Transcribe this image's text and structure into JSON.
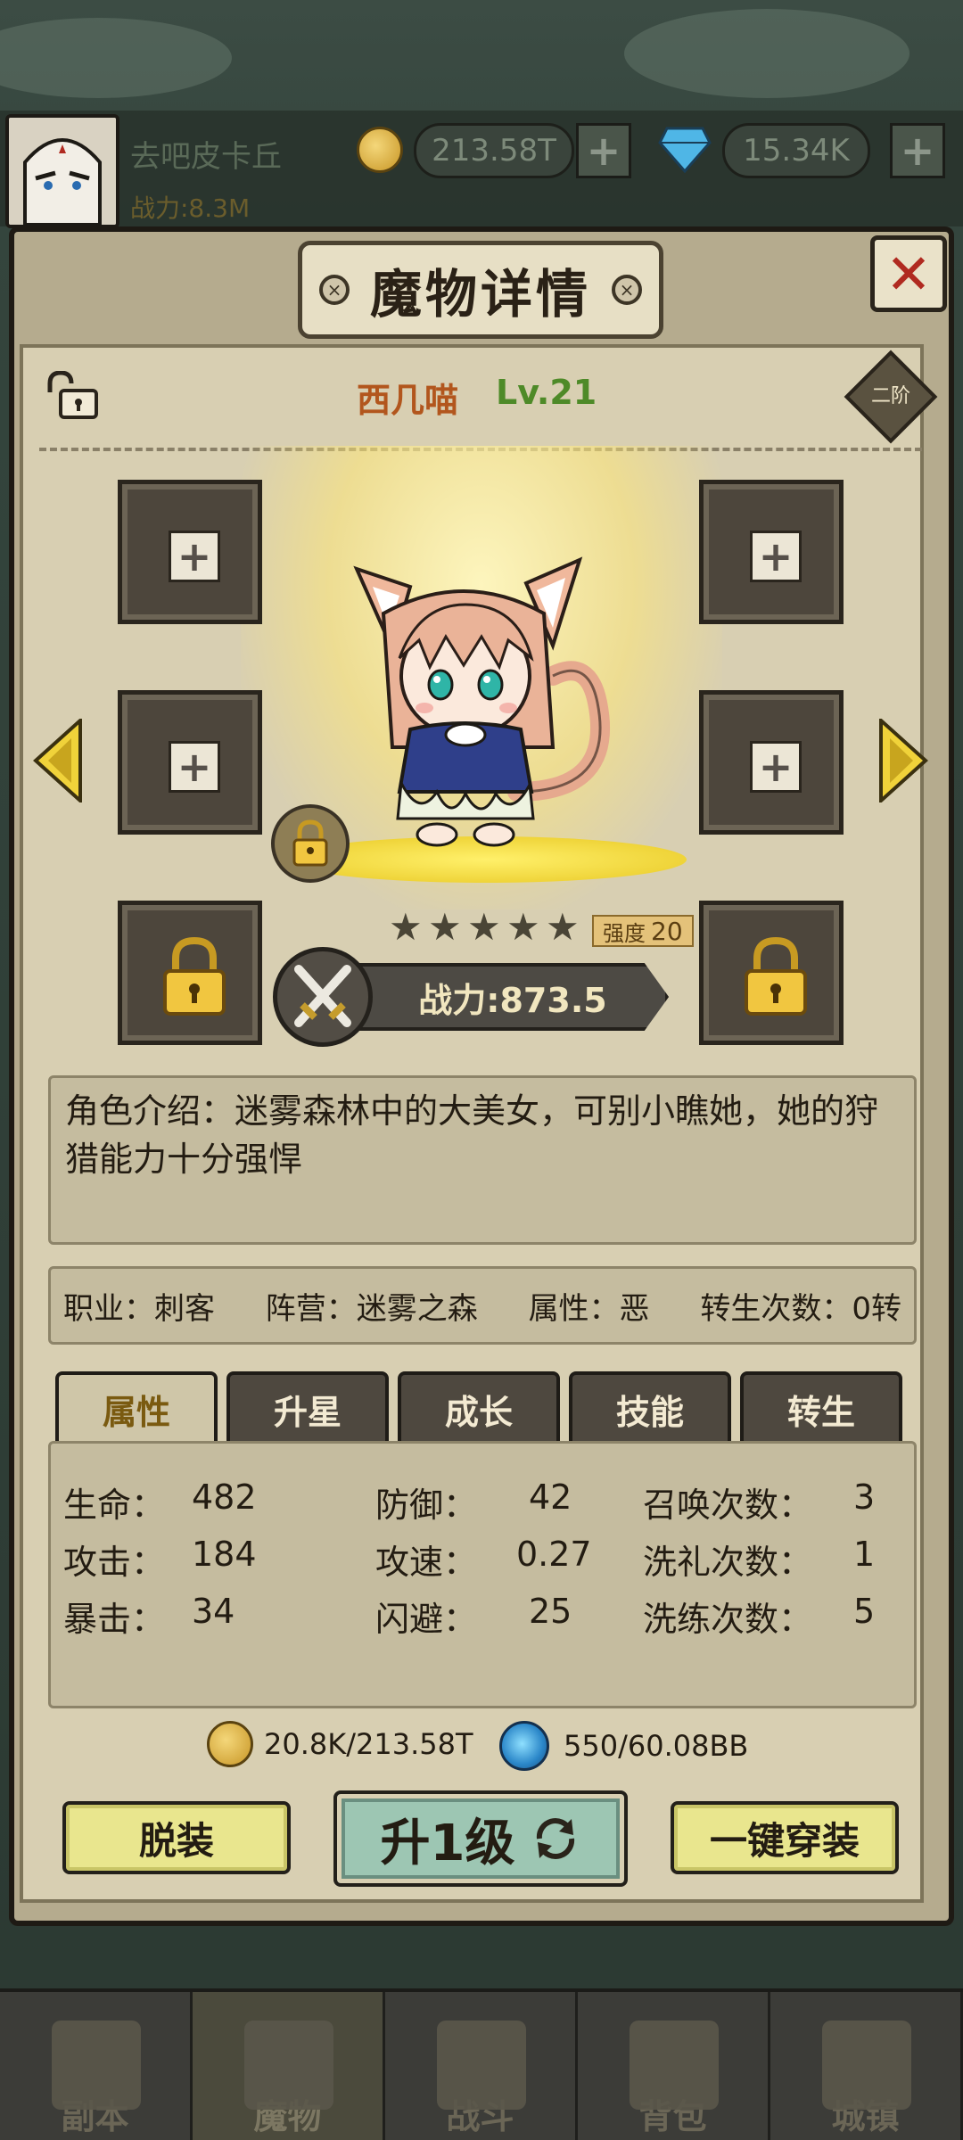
{
  "header": {
    "player_name": "去吧皮卡丘",
    "power_label": "战力:8.3M",
    "gold": "213.58T",
    "gems": "15.34K",
    "plus": "+"
  },
  "panel": {
    "title": "魔物详情",
    "close_label": "✕"
  },
  "monster": {
    "name": "西几喵",
    "level": "Lv.21",
    "rank": "二阶",
    "stars": 5,
    "strength_label": "强度",
    "strength_value": "20",
    "power": "战力:873.5",
    "intro": "角色介绍：迷雾森林中的大美女，可别小瞧她，她的狩猎能力十分强悍",
    "info": {
      "job": "职业：刺客",
      "camp": "阵营：迷雾之森",
      "attribute": "属性：恶",
      "rebirth": "转生次数：0转"
    }
  },
  "equipment_slots": [
    {
      "state": "empty",
      "symbol": "+"
    },
    {
      "state": "empty",
      "symbol": "+"
    },
    {
      "state": "empty",
      "symbol": "+"
    },
    {
      "state": "empty",
      "symbol": "+"
    },
    {
      "state": "locked"
    },
    {
      "state": "locked"
    }
  ],
  "tabs": [
    {
      "label": "属性",
      "active": true
    },
    {
      "label": "升星",
      "active": false
    },
    {
      "label": "成长",
      "active": false
    },
    {
      "label": "技能",
      "active": false
    },
    {
      "label": "转生",
      "active": false
    }
  ],
  "stats": {
    "hp_label": "生命：",
    "hp": "482",
    "atk_label": "攻击：",
    "atk": "184",
    "crit_label": "暴击：",
    "crit": "34",
    "def_label": "防御：",
    "def": "42",
    "spd_label": "攻速：",
    "spd": "0.27",
    "dodge_label": "闪避：",
    "dodge": "25",
    "summon_label": "召唤次数：",
    "summon": "3",
    "baptism_label": "洗礼次数：",
    "baptism": "1",
    "refine_label": "洗练次数：",
    "refine": "5"
  },
  "cost": {
    "gold": "20.8K/213.58T",
    "essence": "550/60.08BB"
  },
  "buttons": {
    "unequip": "脱装",
    "upgrade": "升1级",
    "equip_all": "一键穿装"
  },
  "nav": [
    {
      "label": "副本",
      "icon": "map-icon",
      "active": false
    },
    {
      "label": "魔物",
      "icon": "helmet-icon",
      "active": true
    },
    {
      "label": "战斗",
      "icon": "swords-icon",
      "active": false
    },
    {
      "label": "背包",
      "icon": "backpack-icon",
      "active": false
    },
    {
      "label": "城镇",
      "icon": "house-icon",
      "active": false
    }
  ],
  "colors": {
    "monster_name": "#b2561d",
    "monster_level": "#4e8a28",
    "active_tab_text": "#7a5a10",
    "close_x": "#b02a20"
  }
}
